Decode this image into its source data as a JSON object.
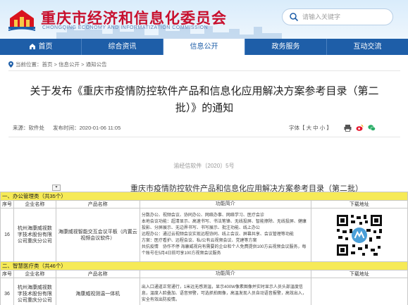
{
  "header": {
    "site_title": "重庆市经济和信息化委员会",
    "site_subtitle": "CHONGQING ECONOMY AND INFORMATIZATION COMMISSION",
    "search_placeholder": "请输入关键字",
    "brand_color": "#c8102e"
  },
  "nav": {
    "items": [
      "首页",
      "综合资讯",
      "信息公开",
      "政务服务",
      "互动交流"
    ],
    "active": "信息公开",
    "bar_color": "#1e5ea8"
  },
  "breadcrumb": {
    "label": "当前位置：",
    "items": [
      "首页",
      "信息公开",
      "通知公告"
    ],
    "sep": " > "
  },
  "article": {
    "title": "关于发布《重庆市疫情防控软件产品和信息化应用解决方案参考目录（第二批）》的通知",
    "source": "来源：软件处",
    "published": "发布时间：2020-01-06 11:05",
    "font_size_label": "字体【 大 中 小 】",
    "doc_number": "渝经信软件〔2020〕5号"
  },
  "table": {
    "title": "重庆市疫情防控软件产品和信息化应用解决方案参考目录（第二批）",
    "dropdown_marker": "▾",
    "categories": [
      "一、办公管理类（共35个）",
      "二、智慧医疗类（共46个）"
    ],
    "headers": [
      "序号",
      "企业名称",
      "产品名称",
      "功能简介",
      "下载地址"
    ],
    "rows": [
      {
        "no": "16",
        "company": "杭州海康威视数字技术股份有限公司重庆分公司",
        "product": "海康威视智能交互会议平板（内置云视频会议软件）",
        "intro": "分数办公、视频会议、协同办公、网络办事、网络学习、医疗会诊\n本地会议功能：超清显示、高速书写、书法笔锋、无线投屏、智能擦除、无线投屏、健康投影、分屏展示、无边界书写、书写展示、批注功能、线上办公\n远程办公：通过云视频会议实现远程协同、线上会议、屏幕共享、会议管理等功能\n方案：医疗看护、远程会议、私/公有云视频会议、党建等方案\n共抗疫情　协作不停 海康威视向有需要的企业和个人免费提供100方云视频会议服务，每个账号在5月4日前可享100方视频会议服务"
      },
      {
        "no": "36",
        "company": "杭州海康威视数字技术股份有限公司重庆分公司",
        "product": "海康威视测温一体机",
        "intro": "出入口通道正常通行，1米远无感测温，显示400W像素图像并实时显示人员头部温度信息，温度人脸叠加、语音预警，可选抓拍图像，高温发现人员自动语音报警，高效出入，安全有效出防疫情。"
      }
    ]
  }
}
